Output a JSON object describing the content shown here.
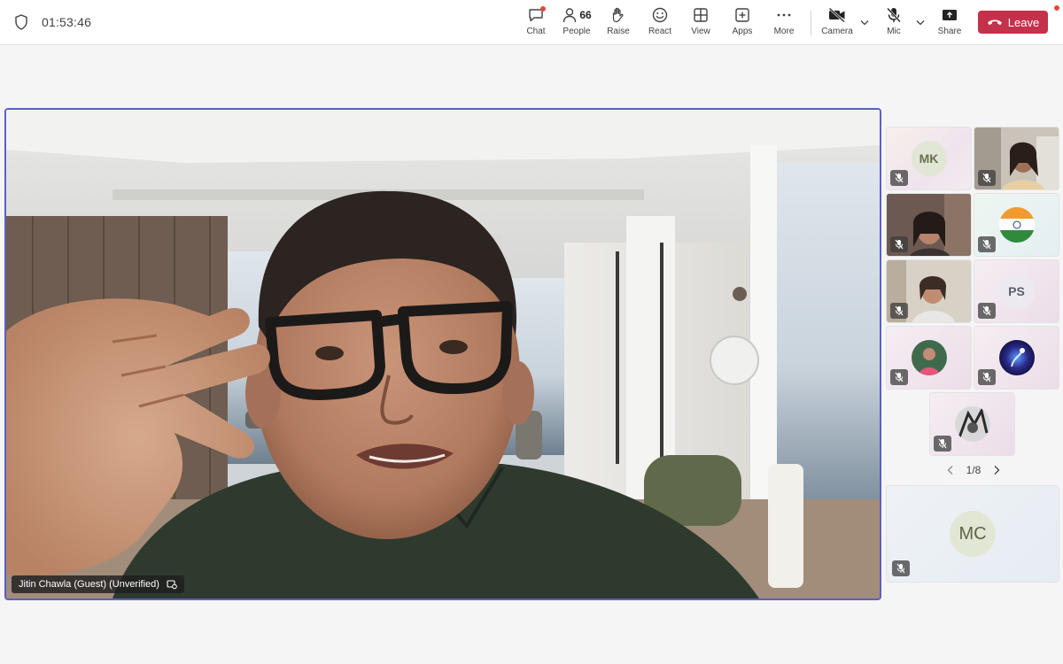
{
  "meeting": {
    "timer": "01:53:46"
  },
  "toolbar": {
    "chat": "Chat",
    "people": "People",
    "people_count": "66",
    "raise": "Raise",
    "react": "React",
    "view": "View",
    "apps": "Apps",
    "more": "More",
    "camera": "Camera",
    "mic": "Mic",
    "share": "Share",
    "leave": "Leave"
  },
  "main_speaker": {
    "name": "Jitin Chawla (Guest) (Unverified)"
  },
  "gallery": {
    "tiles": [
      {
        "initials": "MK"
      },
      {
        "initials": ""
      },
      {
        "initials": ""
      },
      {
        "initials": ""
      },
      {
        "initials": ""
      },
      {
        "initials": "PS"
      },
      {
        "initials": ""
      },
      {
        "initials": ""
      },
      {
        "initials": ""
      }
    ],
    "page": "1/8",
    "featured": {
      "initials": "MC"
    }
  },
  "colors": {
    "accent": "#5b5fc7",
    "leave": "#c4314b"
  }
}
